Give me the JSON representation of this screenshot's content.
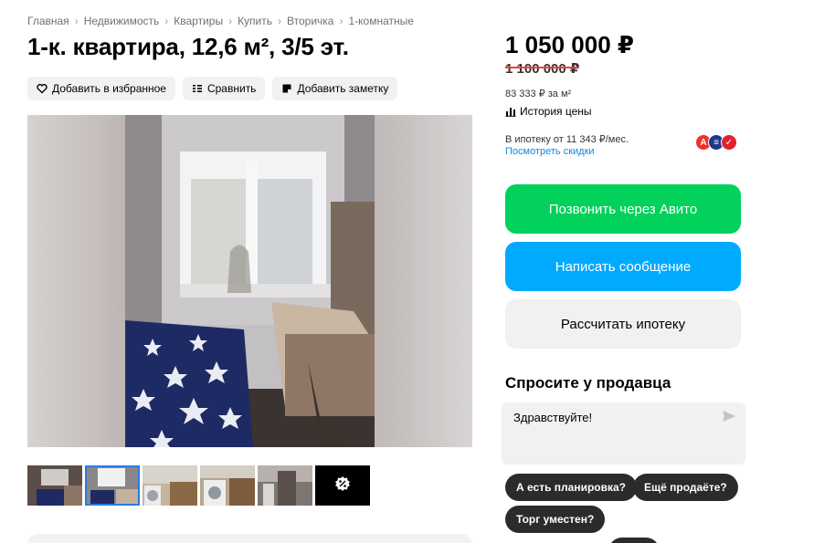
{
  "breadcrumbs": [
    "Главная",
    "Недвижимость",
    "Квартиры",
    "Купить",
    "Вторичка",
    "1-комнатные"
  ],
  "breadcrumb_separator": "›",
  "listing": {
    "title": "1-к. квартира, 12,6 м², 3/5 эт."
  },
  "actions": {
    "favorite": "Добавить в избранное",
    "compare": "Сравнить",
    "note": "Добавить заметку"
  },
  "gallery": {
    "thumbnail_count": 5,
    "active_index": 1,
    "more_icon": "gear-badge-icon"
  },
  "price": {
    "current": "1 050 000 ₽",
    "old": "1 100 000 ₽",
    "per_m2": "83 333 ₽ за м²",
    "history_link": "История цены"
  },
  "mortgage": {
    "text": "В ипотеку от 11 343 ₽/мес.",
    "discounts_link": "Посмотреть скидки",
    "bank_icons": [
      "alfa-bank-icon",
      "bank-icon",
      "bank-icon"
    ]
  },
  "buttons": {
    "call": "Позвонить через Авито",
    "message": "Написать сообщение",
    "calc_mortgage": "Рассчитать ипотеку"
  },
  "ask_seller": {
    "title": "Спросите у продавца",
    "input_value": "Здравствуйте!",
    "quick_questions": [
      "А есть планировка?",
      "Ещё продаёте?",
      "Торг уместен?"
    ]
  },
  "colors": {
    "call_button": "#02d15c",
    "message_button": "#00aaff",
    "link": "#0a8ae6",
    "old_price_strike": "#ff3b3b"
  }
}
